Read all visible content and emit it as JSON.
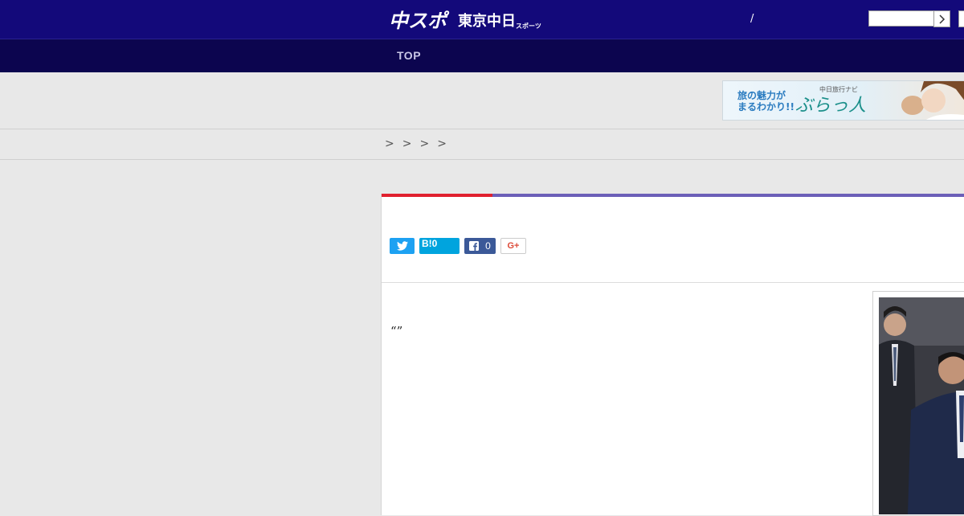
{
  "header": {
    "logo_primary": "中スポ",
    "logo_secondary": "東京中日",
    "logo_small": "スポーツ",
    "slash": "/",
    "search_placeholder": ""
  },
  "nav": {
    "items": [
      {
        "label": "TOP"
      }
    ]
  },
  "banner": {
    "text_line1": "旅の魅力が",
    "text_line2": "まるわかり!!",
    "brand_small": "中日旅行ナビ",
    "brand_main": "ぶらっ人"
  },
  "breadcrumb": {
    "separators": [
      ">",
      ">",
      ">",
      ">"
    ]
  },
  "share": {
    "hatena_label": "B!0",
    "facebook_count": "0",
    "google_label": "G+"
  },
  "article": {
    "quote": "“”"
  },
  "colors": {
    "header_bg": "#13097a",
    "nav_bg": "#0c054f",
    "accent_red": "#e0202e",
    "accent_purple": "#6c5fb8",
    "twitter": "#1da1f2",
    "hatena": "#00a4de",
    "facebook": "#3b5998"
  }
}
